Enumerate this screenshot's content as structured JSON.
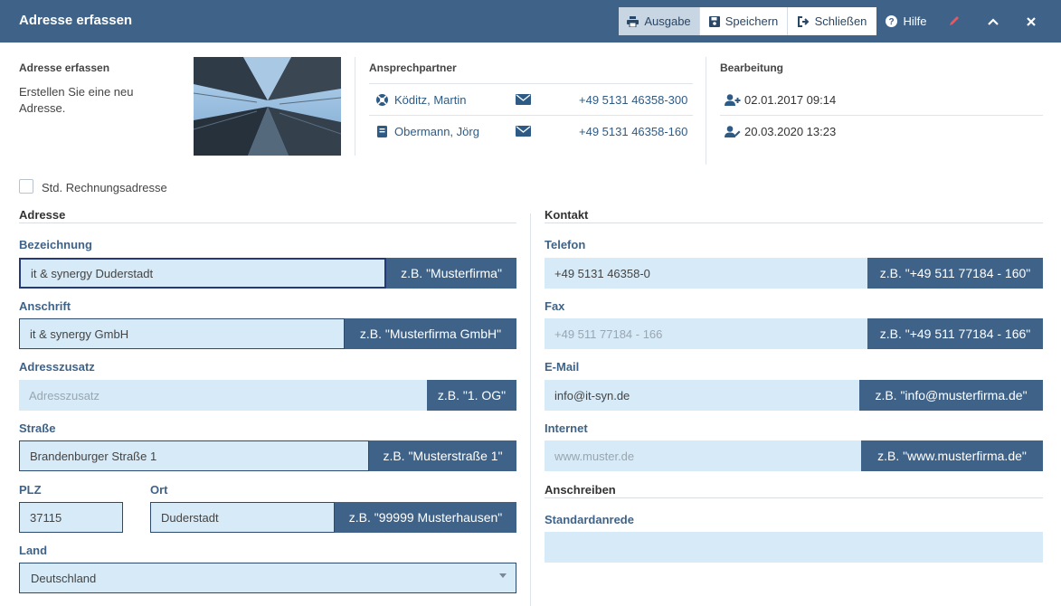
{
  "window": {
    "title": "Adresse erfassen"
  },
  "toolbar": {
    "ausgabe": "Ausgabe",
    "speichern": "Speichern",
    "schliessen": "Schließen",
    "hilfe": "Hilfe"
  },
  "info": {
    "title": "Adresse erfassen",
    "description": "Erstellen Sie eine neu Adresse."
  },
  "ansprechpartner": {
    "title": "Ansprechpartner",
    "persons": [
      {
        "name": "Köditz, Martin",
        "phone": "+49 5131 46358-300",
        "icon": "lifebuoy-icon"
      },
      {
        "name": "Obermann, Jörg",
        "phone": "+49 5131 46358-160",
        "icon": "book-icon"
      }
    ]
  },
  "bearbeitung": {
    "title": "Bearbeitung",
    "created": "02.01.2017 09:14",
    "edited": "20.03.2020 13:23"
  },
  "checkbox": {
    "label": "Std. Rechnungsadresse",
    "checked": false
  },
  "adresse": {
    "heading": "Adresse",
    "bezeichnung": {
      "label": "Bezeichnung",
      "value": "it & synergy Duderstadt",
      "hint": "z.B. \"Musterfirma\""
    },
    "anschrift": {
      "label": "Anschrift",
      "value": "it & synergy GmbH",
      "hint": "z.B. \"Musterfirma GmbH\""
    },
    "adresszusatz": {
      "label": "Adresszusatz",
      "value": "",
      "placeholder": "Adresszusatz",
      "hint": "z.B. \"1. OG\""
    },
    "strasse": {
      "label": "Straße",
      "value": "Brandenburger Straße 1",
      "hint": "z.B. \"Musterstraße 1\""
    },
    "plz": {
      "label": "PLZ",
      "value": "37115"
    },
    "ort": {
      "label": "Ort",
      "value": "Duderstadt",
      "hint": "z.B. \"99999 Musterhausen\""
    },
    "land": {
      "label": "Land",
      "value": "Deutschland"
    }
  },
  "kontakt": {
    "heading": "Kontakt",
    "telefon": {
      "label": "Telefon",
      "value": "+49 5131 46358-0",
      "hint": "z.B. \"+49 511 77184 - 160\""
    },
    "fax": {
      "label": "Fax",
      "value": "",
      "placeholder": "+49 511 77184 - 166",
      "hint": "z.B. \"+49 511 77184 - 166\""
    },
    "email": {
      "label": "E-Mail",
      "value": "info@it-syn.de",
      "hint": "z.B. \"info@musterfirma.de\""
    },
    "internet": {
      "label": "Internet",
      "value": "",
      "placeholder": "www.muster.de",
      "hint": "z.B. \"www.musterfirma.de\""
    }
  },
  "anschreiben": {
    "heading": "Anschreiben",
    "standardanrede": {
      "label": "Standardanrede",
      "value": ""
    }
  },
  "colors": {
    "header": "#3f6388",
    "field": "#d6eaf8",
    "link": "#2d5b86",
    "edit": "#e05a6a"
  }
}
